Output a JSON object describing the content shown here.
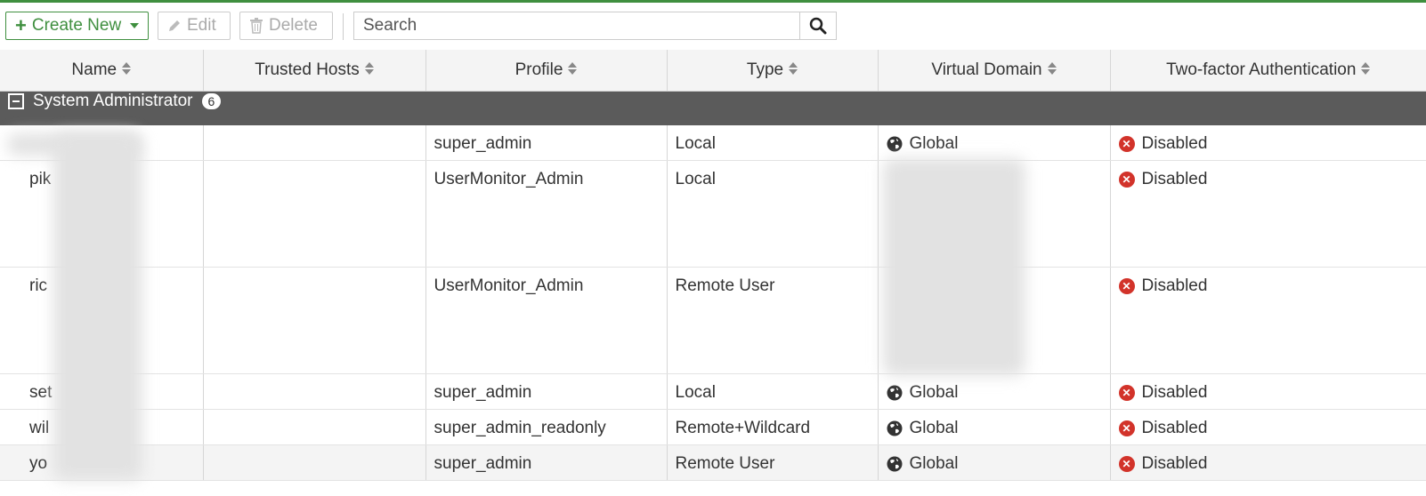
{
  "toolbar": {
    "create_label": "Create New",
    "edit_label": "Edit",
    "delete_label": "Delete",
    "search_placeholder": "Search"
  },
  "table": {
    "headers": [
      "Name",
      "Trusted Hosts",
      "Profile",
      "Type",
      "Virtual Domain",
      "Two-factor Authentication"
    ],
    "group": {
      "label": "System Administrator",
      "count": "6"
    },
    "rows": [
      {
        "name": "",
        "trusted_hosts": "",
        "profile": "super_admin",
        "type": "Local",
        "vdom": "Global",
        "twofa": "Disabled"
      },
      {
        "name": "pik",
        "trusted_hosts": "",
        "profile": "UserMonitor_Admin",
        "type": "Local",
        "vdom": "",
        "twofa": "Disabled"
      },
      {
        "name": "ric",
        "trusted_hosts": "",
        "profile": "UserMonitor_Admin",
        "type": "Remote User",
        "vdom": "",
        "twofa": "Disabled"
      },
      {
        "name": "set",
        "trusted_hosts": "",
        "profile": "super_admin",
        "type": "Local",
        "vdom": "Global",
        "twofa": "Disabled"
      },
      {
        "name": "wil",
        "trusted_hosts": "",
        "profile": "super_admin_readonly",
        "type": "Remote+Wildcard",
        "vdom": "Global",
        "twofa": "Disabled"
      },
      {
        "name": "yo",
        "trusted_hosts": "",
        "profile": "super_admin",
        "type": "Remote User",
        "vdom": "Global",
        "twofa": "Disabled"
      }
    ]
  },
  "colors": {
    "accent": "#3f8f3f",
    "group_bar": "#5b5b5b",
    "disabled_icon": "#d2332a"
  },
  "icons": {
    "create": "plus-icon",
    "edit": "pencil-icon",
    "delete": "trash-icon",
    "search": "search-icon",
    "vdom": "globe-icon",
    "twofa": "x-circle-icon"
  }
}
